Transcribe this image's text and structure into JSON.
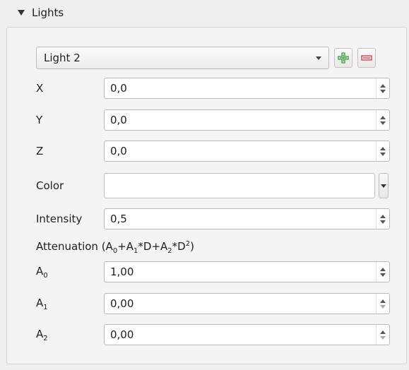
{
  "section": {
    "title": "Lights"
  },
  "light_selector": {
    "value": "Light 2"
  },
  "rows": {
    "x": {
      "label": "X",
      "value": "0,0"
    },
    "y": {
      "label": "Y",
      "value": "0,0"
    },
    "z": {
      "label": "Z",
      "value": "0,0"
    },
    "color": {
      "label": "Color"
    },
    "intensity": {
      "label": "Intensity",
      "value": "0,5"
    },
    "a0": {
      "label": "A",
      "sub": "0",
      "value": "1,00"
    },
    "a1": {
      "label": "A",
      "sub": "1",
      "value": "0,00"
    },
    "a2": {
      "label": "A",
      "sub": "2",
      "value": "0,00"
    }
  },
  "attenuation": {
    "prefix": "Attenuation (A",
    "s0": "0",
    "p1": "+A",
    "s1": "1",
    "p2": "*D+A",
    "s2": "2",
    "p3": "*D",
    "sup": "2",
    "p4": ")"
  },
  "colors": {
    "add": "#3a9a3a",
    "remove": "#d83a4a",
    "swatch": "#ffffff"
  },
  "icons": {
    "add": "plus-icon",
    "remove": "minus-icon",
    "collapse": "triangle-down-icon"
  }
}
